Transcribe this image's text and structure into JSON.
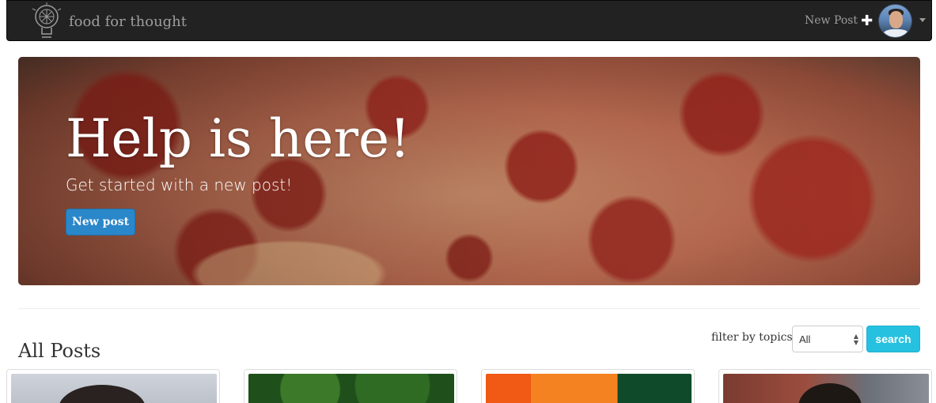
{
  "navbar": {
    "brand": "food for thought",
    "logo_icon": "lightbulb-pizza-logo",
    "new_post_label": "New Post",
    "new_post_icon": "plus-icon",
    "avatar_icon": "user-avatar",
    "menu_icon": "caret-down-icon",
    "bg_color": "#222222"
  },
  "hero": {
    "title": "Help is here!",
    "subtitle": "Get started with a new post!",
    "button_label": "New post",
    "button_color": "#2a87c9"
  },
  "filter": {
    "label": "filter by topics:",
    "selected": "All",
    "search_label": "search",
    "search_color": "#26c1e0"
  },
  "posts": {
    "title": "All Posts",
    "cards": [
      {
        "thumb": "person-photo"
      },
      {
        "thumb": "garden-photo"
      },
      {
        "thumb": "orange-wall-photo"
      },
      {
        "thumb": "person-street-photo"
      }
    ]
  }
}
